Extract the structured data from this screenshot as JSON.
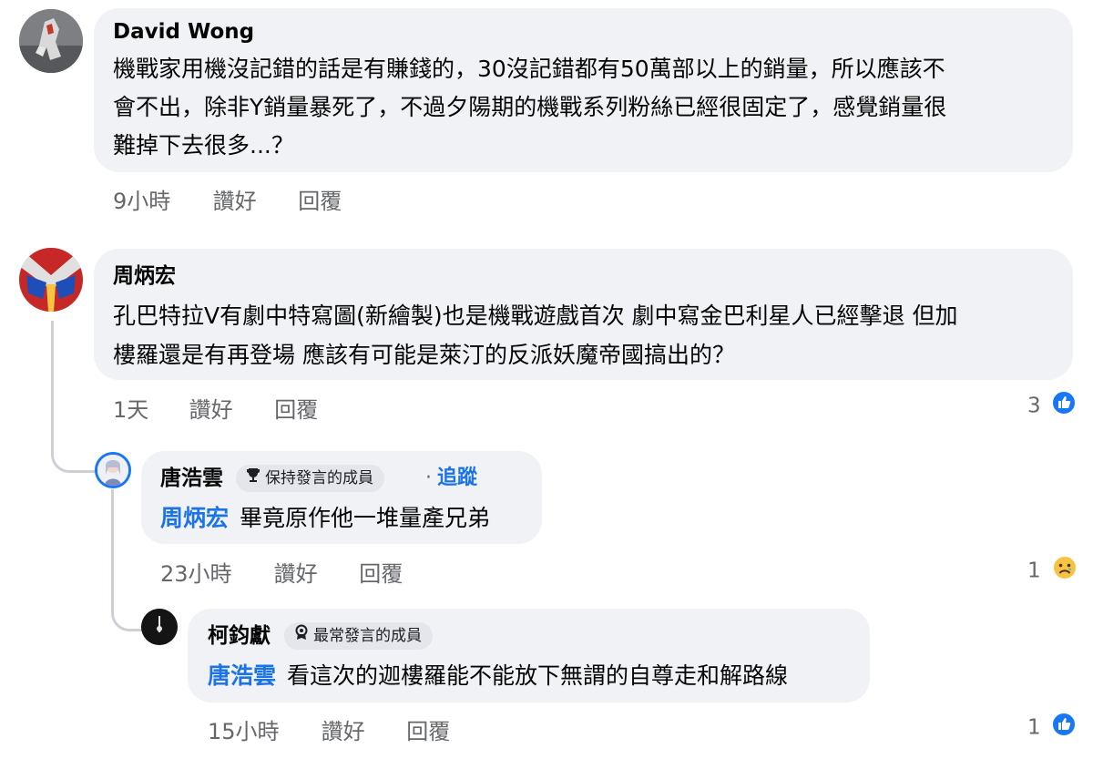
{
  "comments": [
    {
      "author": "David Wong",
      "text_lines": [
        "機戰家用機沒記錯的話是有賺錢的，30沒記錯都有50萬部以上的銷量，所以應該不",
        "會不出，除非Y銷量暴死了，不過夕陽期的機戰系列粉絲已經很固定了，感覺銷量很",
        "難掉下去很多...？"
      ],
      "time": "9小時",
      "like_label": "讚好",
      "reply_label": "回覆"
    },
    {
      "author": "周炳宏",
      "text_lines": [
        "孔巴特拉V有劇中特寫圖(新繪製)也是機戰遊戲首次 劇中寫金巴利星人已經擊退 但加",
        "樓羅還是有再登場 應該有可能是萊汀的反派妖魔帝國搞出的？"
      ],
      "time": "1天",
      "like_label": "讚好",
      "reply_label": "回覆",
      "reaction_count": "3",
      "reaction_type": "like-icon",
      "replies": [
        {
          "author": "唐浩雲",
          "badge": "保持發言的成員",
          "badge_icon": "trophy-icon",
          "follow_label": "追蹤",
          "follow_separator": "·",
          "mention": "周炳宏",
          "text": "畢竟原作他一堆量產兄弟",
          "time": "23小時",
          "like_label": "讚好",
          "reply_label": "回覆",
          "reaction_count": "1",
          "reaction_type": "sad-icon"
        },
        {
          "author": "柯鈞獻",
          "badge": "最常發言的成員",
          "badge_icon": "medal-icon",
          "mention": "唐浩雲",
          "text": "看這次的迦樓羅能不能放下無謂的自尊走和解路線",
          "time": "15小時",
          "like_label": "讚好",
          "reply_label": "回覆",
          "reaction_count": "1",
          "reaction_type": "like-icon"
        }
      ]
    }
  ],
  "colors": {
    "bubble_bg": "#f0f2f5",
    "mention_blue": "#1a73e8",
    "meta_gray": "#65676b",
    "like_blue": "#1877f2",
    "thread_line": "#ccd0d5"
  }
}
